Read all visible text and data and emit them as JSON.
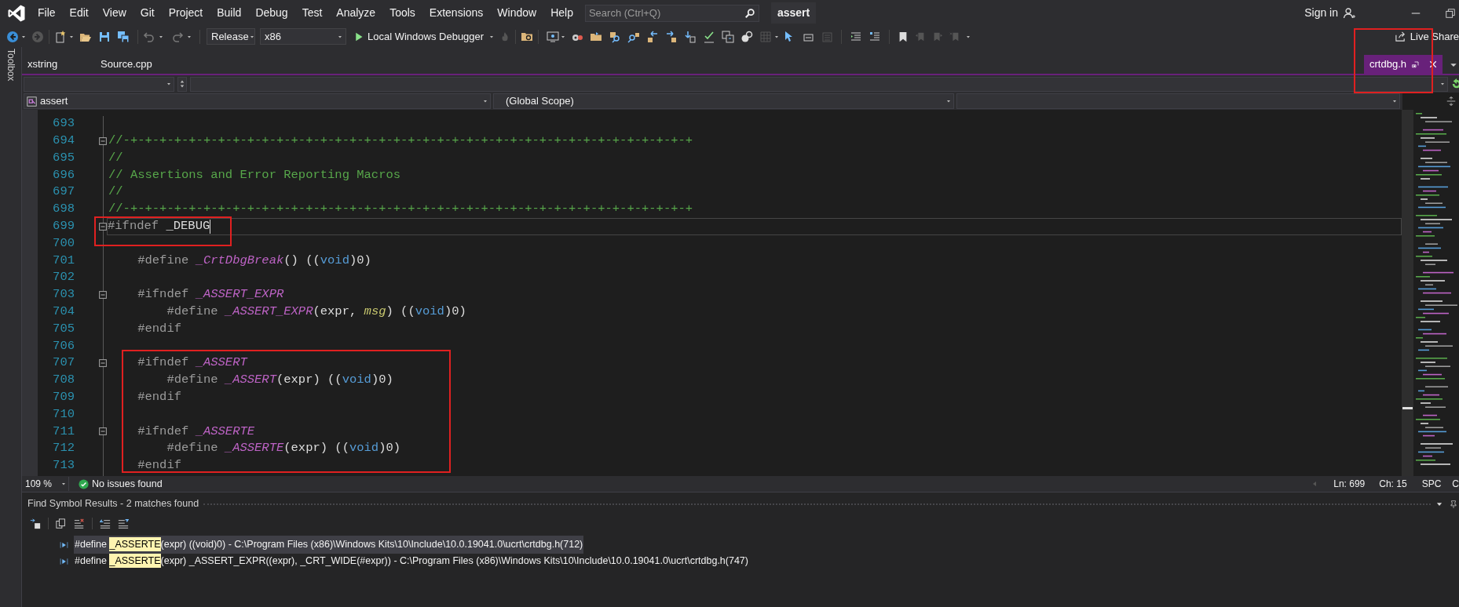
{
  "menu_bar": {
    "items": [
      "File",
      "Edit",
      "View",
      "Git",
      "Project",
      "Build",
      "Debug",
      "Test",
      "Analyze",
      "Tools",
      "Extensions",
      "Window",
      "Help"
    ],
    "search": {
      "placeholder": "Search (Ctrl+Q)"
    },
    "solution_name": "assert",
    "sign_in": "Sign in"
  },
  "toolbox": {
    "label": "Toolbox"
  },
  "toolbar": {
    "configuration": "Release",
    "platform": "x86",
    "debugger": "Local Windows Debugger",
    "live_share": "Live Share"
  },
  "tabs": [
    {
      "label": "xstring",
      "selected": false,
      "preview": false
    },
    {
      "label": "Source.cpp",
      "selected": false,
      "preview": false
    },
    {
      "label": "crtdbg.h",
      "selected": true,
      "preview": true
    }
  ],
  "navigation": {
    "project": "assert",
    "scope": "(Global Scope)"
  },
  "editor": {
    "lines": [
      {
        "number": "693",
        "fold": false,
        "current": false
      },
      {
        "number": "694",
        "fold": true,
        "current": false,
        "tokens": [
          {
            "kind": "comment",
            "text": "//-+-+-+-+-+-+-+-+-+-+-+-+-+-+-+-+-+-+-+-+-+-+-+-+-+-+-+-+-+-+-+-+-+-+-+-+-+-+-+"
          }
        ]
      },
      {
        "number": "695",
        "fold": false,
        "current": false,
        "tokens": [
          {
            "kind": "comment",
            "text": "//"
          }
        ]
      },
      {
        "number": "696",
        "fold": false,
        "current": false,
        "tokens": [
          {
            "kind": "comment",
            "text": "// Assertions and Error Reporting Macros"
          }
        ]
      },
      {
        "number": "697",
        "fold": false,
        "current": false,
        "tokens": [
          {
            "kind": "comment",
            "text": "//"
          }
        ]
      },
      {
        "number": "698",
        "fold": false,
        "current": false,
        "tokens": [
          {
            "kind": "comment",
            "text": "//-+-+-+-+-+-+-+-+-+-+-+-+-+-+-+-+-+-+-+-+-+-+-+-+-+-+-+-+-+-+-+-+-+-+-+-+-+-+-+"
          }
        ]
      },
      {
        "number": "699",
        "fold": true,
        "current": true,
        "tokens": [
          {
            "kind": "directive",
            "text": "#ifndef "
          },
          {
            "kind": "plain",
            "text": "_DEBUG"
          }
        ]
      },
      {
        "number": "700",
        "fold": false,
        "current": false
      },
      {
        "number": "701",
        "fold": false,
        "current": false,
        "tokens": [
          {
            "kind": "directive",
            "text": "    #define "
          },
          {
            "kind": "macro",
            "text": "_CrtDbgBreak"
          },
          {
            "kind": "plain",
            "text": "() (("
          },
          {
            "kind": "keyword",
            "text": "void"
          },
          {
            "kind": "plain",
            "text": ")0)"
          }
        ]
      },
      {
        "number": "702",
        "fold": false,
        "current": false
      },
      {
        "number": "703",
        "fold": true,
        "current": false,
        "tokens": [
          {
            "kind": "directive",
            "text": "    #ifndef "
          },
          {
            "kind": "macro",
            "text": "_ASSERT_EXPR"
          }
        ]
      },
      {
        "number": "704",
        "fold": false,
        "current": false,
        "tokens": [
          {
            "kind": "directive",
            "text": "        #define "
          },
          {
            "kind": "macro",
            "text": "_ASSERT_EXPR"
          },
          {
            "kind": "plain",
            "text": "(expr, "
          },
          {
            "kind": "param",
            "text": "msg"
          },
          {
            "kind": "plain",
            "text": ") (("
          },
          {
            "kind": "keyword",
            "text": "void"
          },
          {
            "kind": "plain",
            "text": ")0)"
          }
        ]
      },
      {
        "number": "705",
        "fold": false,
        "current": false,
        "tokens": [
          {
            "kind": "directive",
            "text": "    #endif"
          }
        ]
      },
      {
        "number": "706",
        "fold": false,
        "current": false
      },
      {
        "number": "707",
        "fold": true,
        "current": false,
        "tokens": [
          {
            "kind": "directive",
            "text": "    #ifndef "
          },
          {
            "kind": "macro",
            "text": "_ASSERT"
          }
        ]
      },
      {
        "number": "708",
        "fold": false,
        "current": false,
        "tokens": [
          {
            "kind": "directive",
            "text": "        #define "
          },
          {
            "kind": "macro",
            "text": "_ASSERT"
          },
          {
            "kind": "plain",
            "text": "(expr) (("
          },
          {
            "kind": "keyword",
            "text": "void"
          },
          {
            "kind": "plain",
            "text": ")0)"
          }
        ]
      },
      {
        "number": "709",
        "fold": false,
        "current": false,
        "tokens": [
          {
            "kind": "directive",
            "text": "    #endif"
          }
        ]
      },
      {
        "number": "710",
        "fold": false,
        "current": false
      },
      {
        "number": "711",
        "fold": true,
        "current": false,
        "tokens": [
          {
            "kind": "directive",
            "text": "    #ifndef "
          },
          {
            "kind": "macro",
            "text": "_ASSERTE"
          }
        ]
      },
      {
        "number": "712",
        "fold": false,
        "current": false,
        "tokens": [
          {
            "kind": "directive",
            "text": "        #define "
          },
          {
            "kind": "macro",
            "text": "_ASSERTE"
          },
          {
            "kind": "plain",
            "text": "(expr) (("
          },
          {
            "kind": "keyword",
            "text": "void"
          },
          {
            "kind": "plain",
            "text": ")0)"
          }
        ]
      },
      {
        "number": "713",
        "fold": false,
        "current": false,
        "tokens": [
          {
            "kind": "directive",
            "text": "    #endif"
          }
        ]
      }
    ]
  },
  "status_bar": {
    "zoom": "109 %",
    "issues": "No issues found",
    "line": "Ln: 699",
    "column": "Ch: 15",
    "spacing": "SPC",
    "line_ending": "C"
  },
  "find_symbol": {
    "title": "Find Symbol Results - 2 matches found",
    "results": [
      {
        "prefix": "#define ",
        "match": "_ASSERTE",
        "suffix": "(expr) ((void)0) - C:\\Program Files (x86)\\Windows Kits\\10\\Include\\10.0.19041.0\\ucrt\\crtdbg.h(712)",
        "selected": true
      },
      {
        "prefix": "#define ",
        "match": "_ASSERTE",
        "suffix": "(expr) _ASSERT_EXPR((expr), _CRT_WIDE(#expr)) - C:\\Program Files (x86)\\Windows Kits\\10\\Include\\10.0.19041.0\\ucrt\\crtdbg.h(747)",
        "selected": false
      }
    ]
  },
  "annotations": [
    {
      "kind": "box"
    },
    {
      "kind": "box"
    },
    {
      "kind": "box"
    }
  ]
}
